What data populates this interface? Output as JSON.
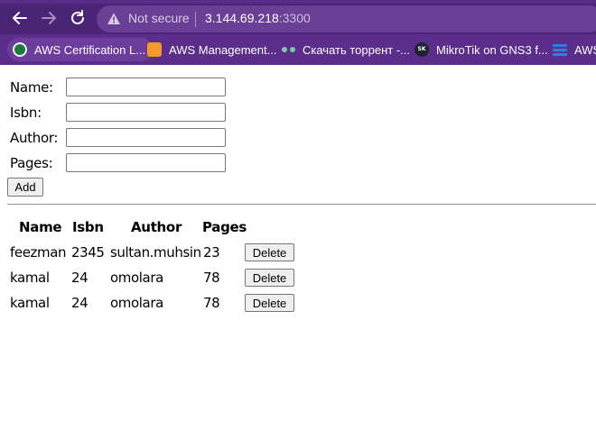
{
  "browser": {
    "security_label": "Not secure",
    "url_host": "3.144.69.218",
    "url_port": ":3300",
    "bookmarks": [
      {
        "label": "AWS Certification L...",
        "icon": "aws-certification-icon"
      },
      {
        "label": "AWS Management...",
        "icon": "aws-cube-icon"
      },
      {
        "label": "Скачать торрент -...",
        "icon": "torrent-icon"
      },
      {
        "label": "MikroTik on GNS3 f...",
        "icon": "mikrotik-icon"
      },
      {
        "label": "AWS",
        "icon": "aws-icon"
      }
    ],
    "colors": {
      "toolbar": "#4b2475",
      "bookmarks_bar": "#5b2e8b"
    }
  },
  "form": {
    "name_label": "Name:",
    "isbn_label": "Isbn:",
    "author_label": "Author:",
    "pages_label": "Pages:",
    "name_value": "",
    "isbn_value": "",
    "author_value": "",
    "pages_value": "",
    "add_label": "Add"
  },
  "table": {
    "headers": [
      "Name",
      "Isbn",
      "Author",
      "Pages"
    ],
    "delete_label": "Delete",
    "rows": [
      {
        "name": "feezman",
        "isbn": "2345",
        "author": "sultan.muhsin",
        "pages": "23"
      },
      {
        "name": "kamal",
        "isbn": "24",
        "author": "omolara",
        "pages": "78"
      },
      {
        "name": "kamal",
        "isbn": "24",
        "author": "omolara",
        "pages": "78"
      }
    ]
  }
}
